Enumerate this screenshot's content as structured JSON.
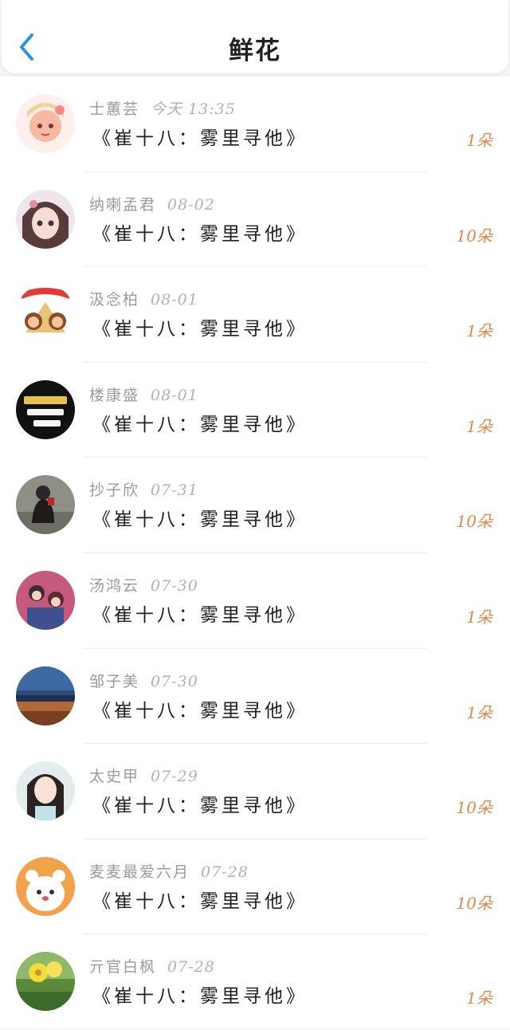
{
  "header": {
    "title": "鲜花",
    "back_icon": "chevron-left-icon",
    "accent_color": "#2a93e6"
  },
  "colors": {
    "count": "#e0884a",
    "name": "#9b9b9b"
  },
  "items": [
    {
      "name": "士蕙芸",
      "date": "今天 13:35",
      "work": "《崔十八：雾里寻他》",
      "count": "1朵",
      "avatar": "anime-girl-avatar"
    },
    {
      "name": "纳喇孟君",
      "date": "08-02",
      "work": "《崔十八：雾里寻他》",
      "count": "10朵",
      "avatar": "anime-girl-avatar"
    },
    {
      "name": "汲念柏",
      "date": "08-01",
      "work": "《崔十八：雾里寻他》",
      "count": "1朵",
      "avatar": "festival-cartoon-avatar"
    },
    {
      "name": "楼康盛",
      "date": "08-01",
      "work": "《崔十八：雾里寻他》",
      "count": "1朵",
      "avatar": "text-logo-avatar"
    },
    {
      "name": "抄子欣",
      "date": "07-31",
      "work": "《崔十八：雾里寻他》",
      "count": "10朵",
      "avatar": "person-photo-avatar"
    },
    {
      "name": "汤鸿云",
      "date": "07-30",
      "work": "《崔十八：雾里寻他》",
      "count": "1朵",
      "avatar": "couple-illustration-avatar"
    },
    {
      "name": "邹子美",
      "date": "07-30",
      "work": "《崔十八：雾里寻他》",
      "count": "1朵",
      "avatar": "landscape-photo-avatar"
    },
    {
      "name": "太史甲",
      "date": "07-29",
      "work": "《崔十八：雾里寻他》",
      "count": "10朵",
      "avatar": "woman-photo-avatar"
    },
    {
      "name": "麦麦最爱六月",
      "date": "07-28",
      "work": "《崔十八：雾里寻他》",
      "count": "10朵",
      "avatar": "cartoon-animal-avatar"
    },
    {
      "name": "亓官白枫",
      "date": "07-28",
      "work": "《崔十八：雾里寻他》",
      "count": "1朵",
      "avatar": "flower-photo-avatar"
    }
  ]
}
